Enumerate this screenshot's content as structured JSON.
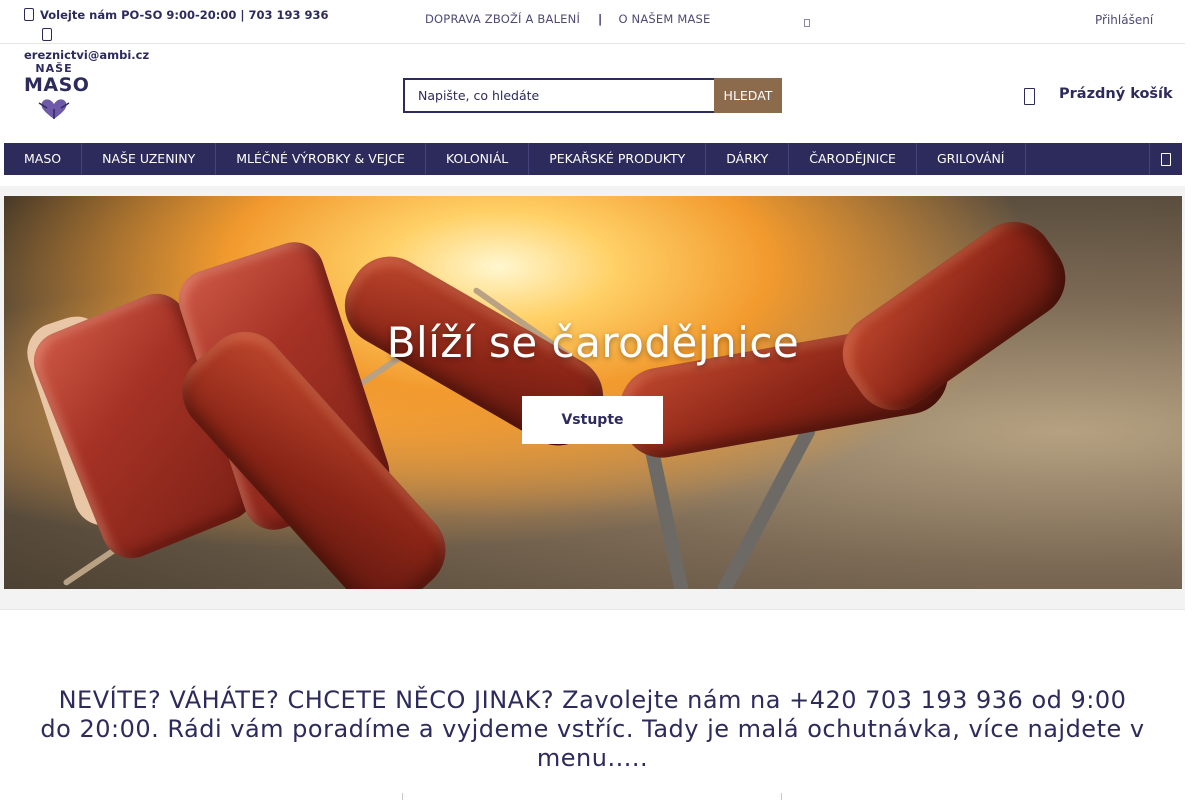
{
  "topbar": {
    "phone_text": "Volejte nám PO-SO 9:00-20:00 | 703 193 936",
    "email": "ereznictvi@ambi.cz",
    "links": [
      "DOPRAVA ZBOŽÍ A BALENÍ",
      "O NAŠEM MASE"
    ],
    "separator": "|",
    "login": "Přihlášení"
  },
  "logo": {
    "line1": "NAŠE",
    "line2": "MASO"
  },
  "search": {
    "placeholder": "Napište, co hledáte",
    "button_label": "HLEDAT"
  },
  "cart": {
    "label": "Prázdný košík"
  },
  "nav": {
    "items": [
      {
        "label": "MASO"
      },
      {
        "label": "NAŠE UZENINY"
      },
      {
        "label": "MLÉČNÉ VÝROBKY & VEJCE"
      },
      {
        "label": "KOLONIÁL"
      },
      {
        "label": "PEKAŘSKÉ PRODUKTY"
      },
      {
        "label": "DÁRKY"
      },
      {
        "label": "ČARODĚJNICE"
      },
      {
        "label": "GRILOVÁNÍ"
      }
    ]
  },
  "hero": {
    "title": "Blíží se čarodějnice",
    "button_label": "Vstupte"
  },
  "promo": {
    "text": "NEVÍTE? VÁHÁTE? CHCETE NĚCO JINAK? Zavolejte nám na +420 703 193 936 od 9:00 do 20:00. Rádi vám poradíme a vyjdeme vstříc. Tady je malá ochutnávka, více najdete v menu....."
  },
  "colors": {
    "brand": "#2d2b5c",
    "accent": "#8c6a4c",
    "nav_bg": "#2d2b5c"
  },
  "icons": [
    "phone-icon",
    "mail-icon",
    "language-icon",
    "shopping-bag-icon",
    "more-menu-icon"
  ]
}
